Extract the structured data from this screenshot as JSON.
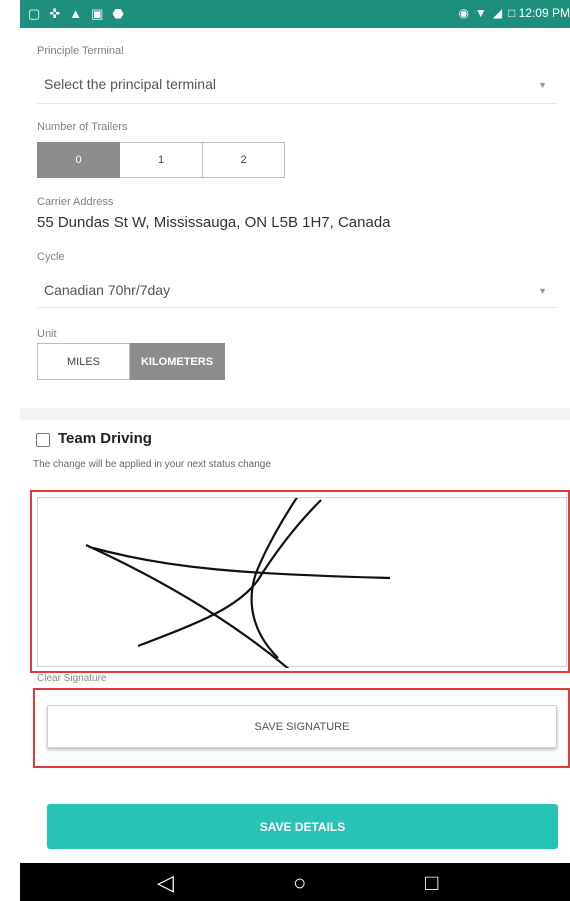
{
  "status_bar": {
    "left_icons": [
      "▢",
      "✜",
      "▲",
      "▣",
      "⬣"
    ],
    "right_icons": [
      "◉",
      "▼",
      "◢"
    ],
    "time": "□ 12:09 PM"
  },
  "form": {
    "principle_terminal": {
      "label": "Principle Terminal",
      "placeholder": "Select the principal terminal"
    },
    "trailers": {
      "label": "Number of Trailers",
      "options": [
        "0",
        "1",
        "2"
      ],
      "selected": "0"
    },
    "carrier_address": {
      "label": "Carrier Address",
      "value": "55 Dundas St W, Mississauga, ON L5B 1H7, Canada"
    },
    "cycle": {
      "label": "Cycle",
      "value": "Canadian 70hr/7day"
    },
    "unit": {
      "label": "Unit",
      "options": [
        "MILES",
        "KILOMETERS"
      ],
      "selected": "KILOMETERS"
    }
  },
  "team_driving": {
    "label": "Team Driving",
    "checked": false,
    "note": "The change will be applied in your next status change"
  },
  "signature": {
    "clear_label": "Clear Signature",
    "save_label": "SAVE SIGNATURE"
  },
  "save_details_label": "SAVE DETAILS",
  "nav": {
    "back": "◁",
    "home": "○",
    "recents": "□"
  },
  "colors": {
    "status_bar": "#1f8f7d",
    "primary_button": "#27c3b4",
    "selected_segment": "#8c8c8c",
    "highlight_frame": "#e33b3b"
  }
}
